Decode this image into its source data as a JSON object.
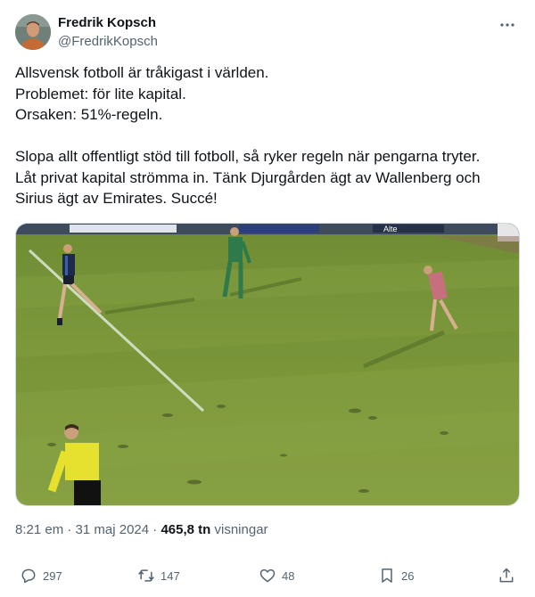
{
  "author": {
    "name": "Fredrik Kopsch",
    "handle": "@FredrikKopsch"
  },
  "tweet": {
    "lines": [
      "Allsvensk fotboll är tråkigast i världen.",
      "Problemet: för lite kapital.",
      "Orsaken: 51%-regeln.",
      "Slopa allt offentligt stöd till fotboll, så ryker regeln när pengarna tryter.",
      "Låt privat kapital strömma in. Tänk Djurgården ägt av Wallenberg och",
      "Sirius ägt av Emirates. Succé!"
    ]
  },
  "media": {
    "ad_board_text": "Alte"
  },
  "meta": {
    "time": "8:21 em",
    "separator": "·",
    "date": "31 maj 2024",
    "views_count": "465,8 tn",
    "views_label": "visningar"
  },
  "actions": {
    "replies": "297",
    "reposts": "147",
    "likes": "48",
    "bookmarks": "26"
  },
  "colors": {
    "text": "#0f1419",
    "secondary": "#536471",
    "border": "#cfd9de",
    "pitch": "#7f9a3c"
  },
  "icons": [
    "more-icon",
    "reply-icon",
    "repost-icon",
    "like-icon",
    "bookmark-icon",
    "share-icon"
  ]
}
